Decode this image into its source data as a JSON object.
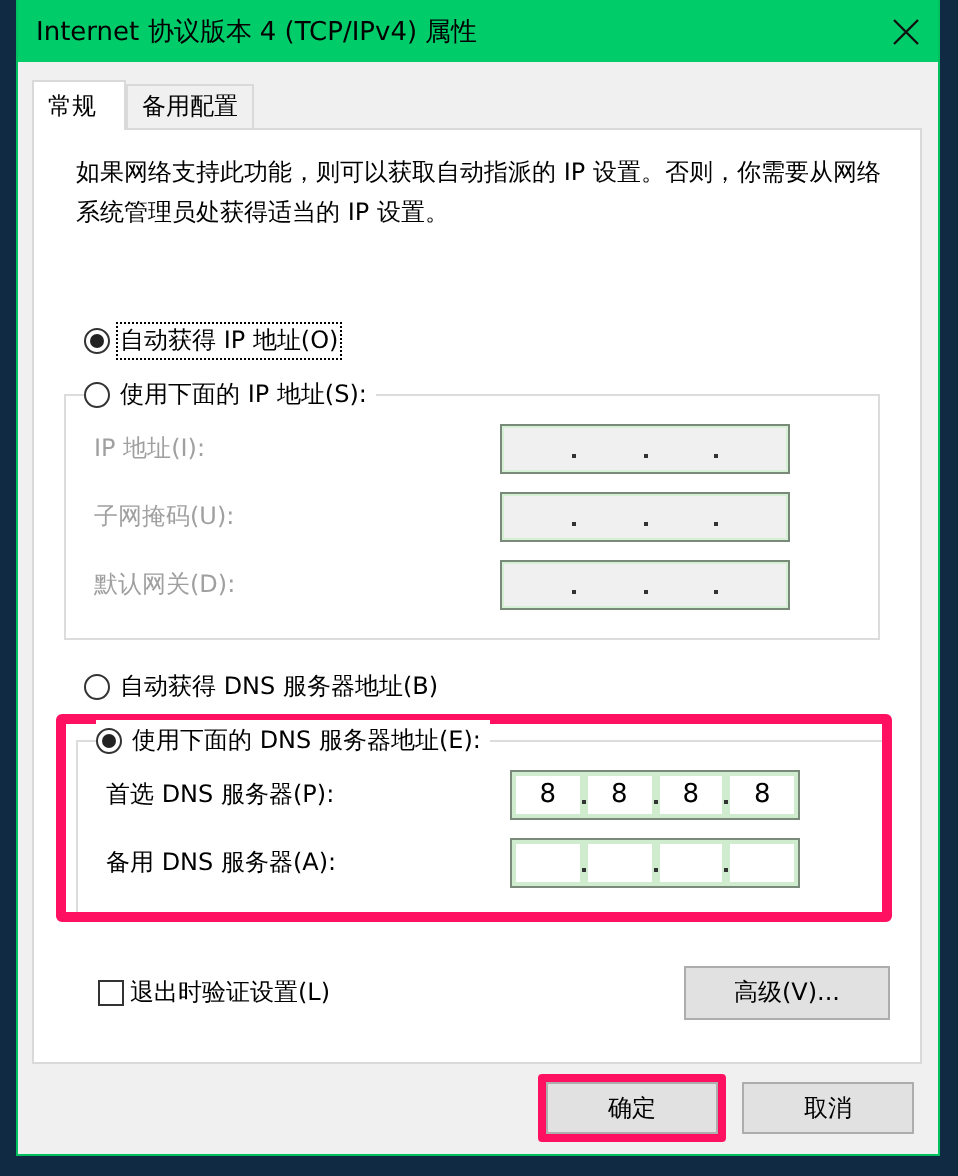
{
  "window": {
    "title": "Internet 协议版本 4 (TCP/IPv4) 属性"
  },
  "tabs": [
    {
      "label": "常规",
      "selected": true
    },
    {
      "label": "备用配置",
      "selected": false
    }
  ],
  "description": "如果网络支持此功能，则可以获取自动指派的 IP 设置。否则，你需要从网络系统管理员处获得适当的 IP 设置。",
  "ip_mode": [
    {
      "label": "自动获得 IP 地址(O)",
      "selected": true,
      "focused": true
    },
    {
      "label": "使用下面的 IP 地址(S):",
      "selected": false,
      "focused": false
    }
  ],
  "ip_fields": [
    {
      "label": "IP 地址(I):",
      "disabled": true
    },
    {
      "label": "子网掩码(U):",
      "disabled": true
    },
    {
      "label": "默认网关(D):",
      "disabled": true
    }
  ],
  "dns_mode": [
    {
      "label": "自动获得 DNS 服务器地址(B)",
      "selected": false
    },
    {
      "label": "使用下面的 DNS 服务器地址(E):",
      "selected": true
    }
  ],
  "dns_highlighted": true,
  "dns_fields": [
    {
      "label": "首选 DNS 服务器(P):",
      "octets": [
        "8",
        "8",
        "8",
        "8"
      ]
    },
    {
      "label": "备用 DNS 服务器(A):"
    }
  ],
  "validate_on_exit": {
    "label": "退出时验证设置(L)",
    "checked": false
  },
  "advanced_button": "高级(V)...",
  "buttons": [
    {
      "label": "确定",
      "highlighted": true
    },
    {
      "label": "取消",
      "highlighted": false
    }
  ]
}
